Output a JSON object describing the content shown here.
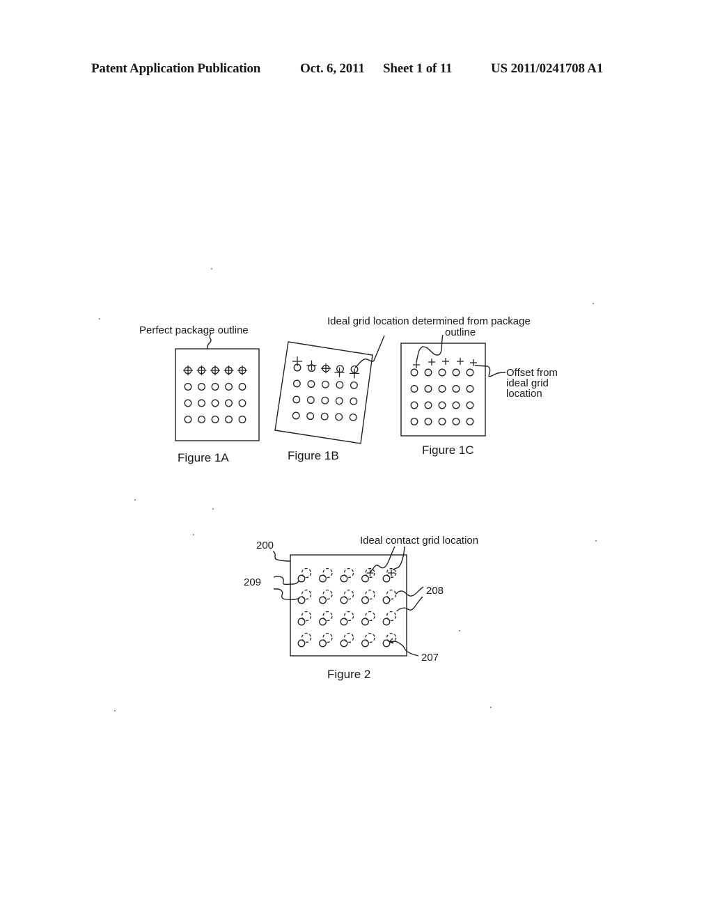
{
  "header": {
    "publication_type": "Patent Application Publication",
    "date": "Oct. 6, 2011",
    "sheet": "Sheet 1 of 11",
    "publication_number": "US 2011/0241708 A1"
  },
  "figures": {
    "fig1a": {
      "caption": "Figure 1A",
      "label": "Perfect package outline",
      "grid_rows": 4,
      "grid_cols": 5,
      "first_row_marker": "crosshair-centered"
    },
    "fig1b": {
      "caption": "Figure 1B",
      "label": "Ideal grid location determined from package",
      "label_line2": "outline",
      "grid_rows": 4,
      "grid_cols": 5,
      "first_row_marker": "crosshair-offset"
    },
    "fig1c": {
      "caption": "Figure 1C",
      "label": "Offset from",
      "label_line2": "ideal grid",
      "label_line3": "location",
      "grid_rows": 4,
      "grid_cols": 5,
      "first_row_marker": "cross-above"
    },
    "fig2": {
      "caption": "Figure 2",
      "label": "Ideal contact grid location",
      "refs": {
        "package": "200",
        "contact": "209",
        "ideal_location": "208",
        "offset": "207"
      },
      "grid_rows": 4,
      "grid_cols": 5
    }
  }
}
